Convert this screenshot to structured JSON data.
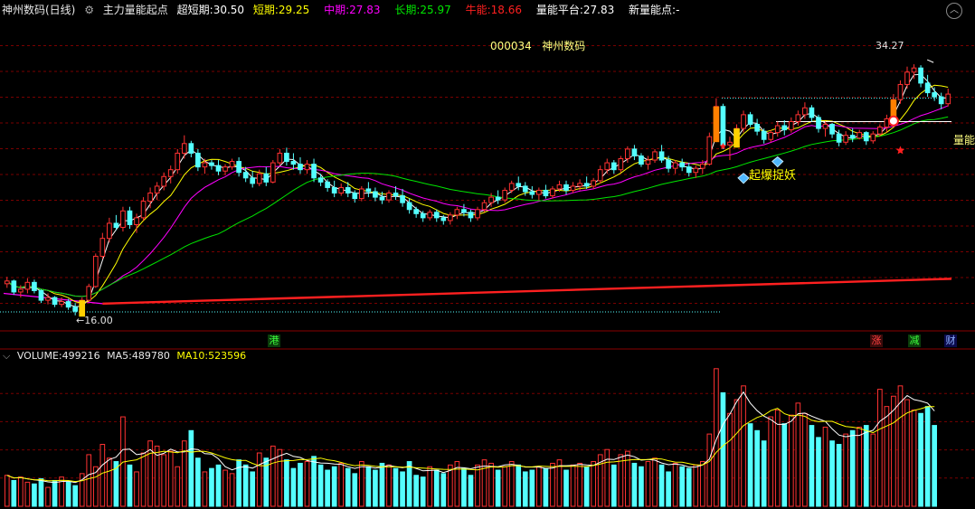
{
  "header": {
    "title": "神州数码(日线)",
    "indicator_name": "主力量能起点",
    "ultra_short_label": "超短期:",
    "ultra_short_value": "30.50",
    "short_label": "短期:",
    "short_value": "29.25",
    "mid_label": "中期:",
    "mid_value": "27.83",
    "long_label": "长期:",
    "long_value": "25.97",
    "bull_label": "牛能:",
    "bull_value": "18.66",
    "platform_label": "量能平台:",
    "platform_value": "27.83",
    "new_point_label": "新量能点:",
    "new_point_value": "-"
  },
  "stock": {
    "code": "000034",
    "name": "神州数码"
  },
  "annotations": {
    "high": "34.27",
    "low": "16.00",
    "capture_label": "起爆捉妖",
    "platform_tag": "量能",
    "port_marker": "港",
    "tag_rise": "涨",
    "tag_reduce": "减",
    "tag_fin": "财"
  },
  "volume_header": {
    "volume_label": "VOLUME:",
    "volume_value": "499216",
    "ma5_label": "MA5:",
    "ma5_value": "489780",
    "ma10_label": "MA10:",
    "ma10_value": "523596"
  },
  "colors": {
    "up": "#ff3232",
    "down": "#54ffff",
    "ma_white": "#ffffff",
    "ma_yellow": "#ffff00",
    "ma_magenta": "#ff00ff",
    "ma_green": "#00e600",
    "bull_line": "#ff2020",
    "grid": "#7a0000"
  },
  "chart_data": {
    "type": "candlestick",
    "price_ylim": [
      15.0,
      37.5
    ],
    "candles": [
      [
        18.3,
        18.8,
        18.0,
        18.5
      ],
      [
        18.5,
        18.6,
        17.5,
        17.7
      ],
      [
        17.7,
        18.2,
        17.3,
        17.9
      ],
      [
        17.9,
        18.7,
        17.6,
        18.4
      ],
      [
        18.4,
        18.6,
        17.6,
        17.8
      ],
      [
        17.8,
        17.9,
        16.9,
        17.1
      ],
      [
        17.1,
        17.6,
        16.8,
        17.3
      ],
      [
        17.3,
        17.4,
        16.6,
        16.8
      ],
      [
        16.8,
        17.3,
        16.6,
        17.0
      ],
      [
        17.0,
        17.2,
        16.4,
        16.6
      ],
      [
        16.6,
        16.9,
        16.0,
        16.3
      ],
      [
        16.3,
        17.3,
        16.1,
        17.1
      ],
      [
        17.1,
        18.3,
        17.0,
        18.1
      ],
      [
        18.1,
        20.5,
        18.0,
        20.3
      ],
      [
        20.3,
        22.0,
        20.1,
        21.6
      ],
      [
        21.6,
        23.1,
        21.3,
        22.7
      ],
      [
        22.7,
        23.3,
        22.2,
        22.4
      ],
      [
        22.4,
        23.9,
        22.1,
        23.6
      ],
      [
        23.6,
        23.9,
        22.3,
        22.6
      ],
      [
        22.6,
        23.4,
        22.0,
        23.1
      ],
      [
        23.1,
        24.6,
        22.9,
        24.3
      ],
      [
        24.3,
        25.3,
        23.8,
        24.9
      ],
      [
        24.9,
        25.7,
        24.4,
        25.4
      ],
      [
        25.4,
        26.4,
        25.1,
        26.1
      ],
      [
        26.1,
        26.9,
        25.6,
        26.6
      ],
      [
        26.6,
        28.1,
        26.3,
        27.8
      ],
      [
        27.8,
        29.1,
        27.4,
        28.5
      ],
      [
        28.5,
        28.7,
        27.5,
        27.8
      ],
      [
        27.8,
        28.1,
        26.5,
        26.8
      ],
      [
        26.8,
        27.4,
        26.3,
        27.1
      ],
      [
        27.1,
        27.3,
        26.6,
        26.9
      ],
      [
        26.9,
        27.3,
        26.2,
        26.5
      ],
      [
        26.5,
        27.0,
        26.2,
        26.8
      ],
      [
        26.8,
        27.4,
        26.6,
        27.2
      ],
      [
        27.2,
        27.5,
        26.1,
        26.4
      ],
      [
        26.4,
        26.8,
        25.7,
        26.0
      ],
      [
        26.0,
        26.5,
        25.3,
        25.6
      ],
      [
        25.6,
        26.6,
        25.4,
        26.3
      ],
      [
        26.3,
        26.8,
        25.4,
        25.7
      ],
      [
        25.7,
        27.3,
        25.6,
        27.1
      ],
      [
        27.1,
        28.1,
        26.9,
        27.8
      ],
      [
        27.8,
        28.2,
        26.9,
        27.2
      ],
      [
        27.2,
        27.8,
        26.6,
        27.0
      ],
      [
        27.0,
        27.5,
        26.3,
        26.6
      ],
      [
        26.6,
        27.3,
        26.3,
        27.0
      ],
      [
        27.0,
        27.4,
        25.7,
        26.0
      ],
      [
        26.0,
        26.3,
        25.4,
        25.7
      ],
      [
        25.7,
        25.9,
        25.0,
        25.3
      ],
      [
        25.3,
        25.8,
        24.6,
        24.9
      ],
      [
        24.9,
        25.6,
        24.7,
        25.3
      ],
      [
        25.3,
        25.7,
        24.6,
        24.9
      ],
      [
        24.9,
        25.1,
        24.2,
        24.5
      ],
      [
        24.5,
        25.4,
        24.3,
        25.2
      ],
      [
        25.2,
        25.7,
        24.6,
        25.0
      ],
      [
        25.0,
        25.3,
        24.3,
        24.6
      ],
      [
        24.6,
        25.0,
        24.1,
        24.4
      ],
      [
        24.4,
        25.1,
        24.2,
        24.9
      ],
      [
        24.9,
        25.4,
        24.4,
        24.7
      ],
      [
        24.7,
        25.2,
        23.9,
        24.2
      ],
      [
        24.2,
        24.5,
        23.4,
        23.7
      ],
      [
        23.7,
        23.9,
        23.1,
        23.4
      ],
      [
        23.4,
        23.6,
        22.8,
        23.1
      ],
      [
        23.1,
        23.7,
        22.9,
        23.5
      ],
      [
        23.5,
        23.7,
        22.8,
        23.1
      ],
      [
        23.1,
        23.3,
        22.6,
        22.9
      ],
      [
        22.9,
        23.5,
        22.6,
        23.3
      ],
      [
        23.3,
        23.9,
        23.0,
        23.7
      ],
      [
        23.7,
        24.1,
        23.2,
        23.5
      ],
      [
        23.5,
        23.7,
        22.8,
        23.1
      ],
      [
        23.1,
        23.9,
        22.9,
        23.7
      ],
      [
        23.7,
        24.4,
        23.5,
        24.2
      ],
      [
        24.2,
        24.9,
        23.9,
        24.6
      ],
      [
        24.6,
        25.1,
        24.1,
        24.4
      ],
      [
        24.4,
        25.3,
        24.2,
        25.1
      ],
      [
        25.1,
        25.8,
        24.9,
        25.6
      ],
      [
        25.6,
        26.1,
        25.1,
        25.4
      ],
      [
        25.4,
        25.7,
        24.7,
        25.0
      ],
      [
        25.0,
        25.4,
        24.5,
        24.8
      ],
      [
        24.8,
        25.3,
        24.4,
        25.1
      ],
      [
        25.1,
        25.5,
        24.5,
        24.7
      ],
      [
        24.7,
        25.4,
        24.5,
        25.2
      ],
      [
        25.2,
        25.8,
        25.0,
        25.5
      ],
      [
        25.5,
        25.8,
        24.8,
        25.1
      ],
      [
        25.1,
        25.7,
        24.9,
        25.4
      ],
      [
        25.4,
        25.9,
        25.1,
        25.6
      ],
      [
        25.6,
        26.1,
        25.2,
        25.4
      ],
      [
        25.4,
        26.0,
        25.2,
        25.8
      ],
      [
        25.8,
        26.9,
        25.6,
        26.6
      ],
      [
        26.6,
        27.4,
        26.3,
        27.1
      ],
      [
        27.1,
        27.3,
        26.3,
        26.6
      ],
      [
        26.6,
        27.6,
        26.4,
        27.4
      ],
      [
        27.4,
        28.3,
        27.1,
        28.1
      ],
      [
        28.1,
        28.4,
        27.3,
        27.6
      ],
      [
        27.6,
        27.8,
        26.8,
        27.0
      ],
      [
        27.0,
        27.6,
        26.6,
        27.3
      ],
      [
        27.3,
        28.1,
        27.1,
        27.9
      ],
      [
        27.9,
        28.4,
        27.1,
        27.3
      ],
      [
        27.3,
        27.6,
        26.4,
        26.7
      ],
      [
        26.7,
        27.3,
        26.3,
        27.1
      ],
      [
        27.1,
        27.4,
        26.5,
        26.8
      ],
      [
        26.8,
        27.1,
        26.1,
        26.4
      ],
      [
        26.4,
        26.9,
        26.0,
        26.7
      ],
      [
        26.7,
        27.3,
        26.3,
        27.0
      ],
      [
        27.0,
        29.3,
        26.9,
        29.0
      ],
      [
        29.0,
        31.8,
        28.7,
        31.2
      ],
      [
        31.2,
        31.4,
        28.1,
        28.4
      ],
      [
        28.4,
        29.0,
        27.3,
        28.6
      ],
      [
        28.6,
        29.9,
        28.4,
        29.6
      ],
      [
        29.6,
        30.9,
        29.3,
        30.6
      ],
      [
        30.6,
        30.8,
        29.7,
        29.9
      ],
      [
        29.9,
        30.3,
        29.1,
        29.4
      ],
      [
        29.4,
        29.6,
        28.5,
        28.8
      ],
      [
        28.8,
        29.5,
        28.6,
        29.3
      ],
      [
        29.3,
        30.1,
        29.0,
        29.8
      ],
      [
        29.8,
        30.2,
        29.1,
        29.5
      ],
      [
        29.5,
        30.4,
        29.3,
        30.1
      ],
      [
        30.1,
        30.9,
        29.8,
        30.6
      ],
      [
        30.6,
        31.5,
        30.3,
        31.1
      ],
      [
        31.1,
        31.3,
        30.1,
        30.4
      ],
      [
        30.4,
        30.6,
        29.3,
        29.6
      ],
      [
        29.6,
        30.1,
        29.0,
        29.9
      ],
      [
        29.9,
        30.0,
        28.9,
        29.2
      ],
      [
        29.2,
        29.5,
        28.3,
        28.6
      ],
      [
        28.6,
        29.4,
        28.4,
        29.1
      ],
      [
        29.1,
        29.6,
        28.6,
        28.9
      ],
      [
        28.9,
        29.5,
        28.8,
        29.3
      ],
      [
        29.3,
        29.4,
        28.4,
        28.7
      ],
      [
        28.7,
        29.4,
        28.5,
        29.2
      ],
      [
        29.2,
        29.9,
        29.0,
        29.7
      ],
      [
        29.7,
        30.6,
        29.3,
        30.3
      ],
      [
        30.3,
        32.1,
        30.0,
        31.7
      ],
      [
        31.7,
        33.1,
        31.4,
        32.8
      ],
      [
        32.8,
        34.1,
        32.5,
        33.7
      ],
      [
        33.7,
        34.27,
        33.2,
        34.0
      ],
      [
        34.0,
        34.2,
        32.6,
        32.9
      ],
      [
        32.9,
        33.5,
        31.9,
        32.2
      ],
      [
        32.2,
        32.6,
        31.6,
        31.9
      ],
      [
        31.9,
        32.2,
        31.0,
        31.4
      ],
      [
        31.4,
        32.5,
        31.2,
        32.1
      ]
    ],
    "volumes": [
      180,
      150,
      170,
      140,
      130,
      160,
      110,
      150,
      170,
      140,
      120,
      190,
      300,
      230,
      360,
      280,
      260,
      520,
      240,
      200,
      310,
      380,
      350,
      300,
      320,
      230,
      380,
      440,
      280,
      200,
      220,
      240,
      210,
      190,
      270,
      240,
      200,
      310,
      280,
      350,
      330,
      270,
      220,
      250,
      260,
      290,
      240,
      210,
      230,
      250,
      220,
      190,
      260,
      230,
      210,
      250,
      240,
      220,
      200,
      260,
      180,
      170,
      230,
      210,
      190,
      240,
      260,
      220,
      180,
      240,
      270,
      250,
      210,
      230,
      260,
      240,
      200,
      210,
      230,
      220,
      250,
      270,
      210,
      240,
      250,
      230,
      260,
      300,
      330,
      240,
      300,
      320,
      250,
      230,
      260,
      280,
      240,
      200,
      250,
      230,
      220,
      240,
      260,
      420,
      800,
      660,
      540,
      620,
      700,
      480,
      440,
      380,
      520,
      560,
      480,
      530,
      600,
      540,
      470,
      400,
      460,
      380,
      360,
      420,
      440,
      460,
      470,
      420,
      680,
      580,
      640,
      700,
      620,
      560,
      540,
      580,
      470
    ],
    "vol_ylim": [
      0,
      820
    ],
    "ma_colors_order": [
      "white",
      "yellow",
      "magenta",
      "green"
    ]
  }
}
